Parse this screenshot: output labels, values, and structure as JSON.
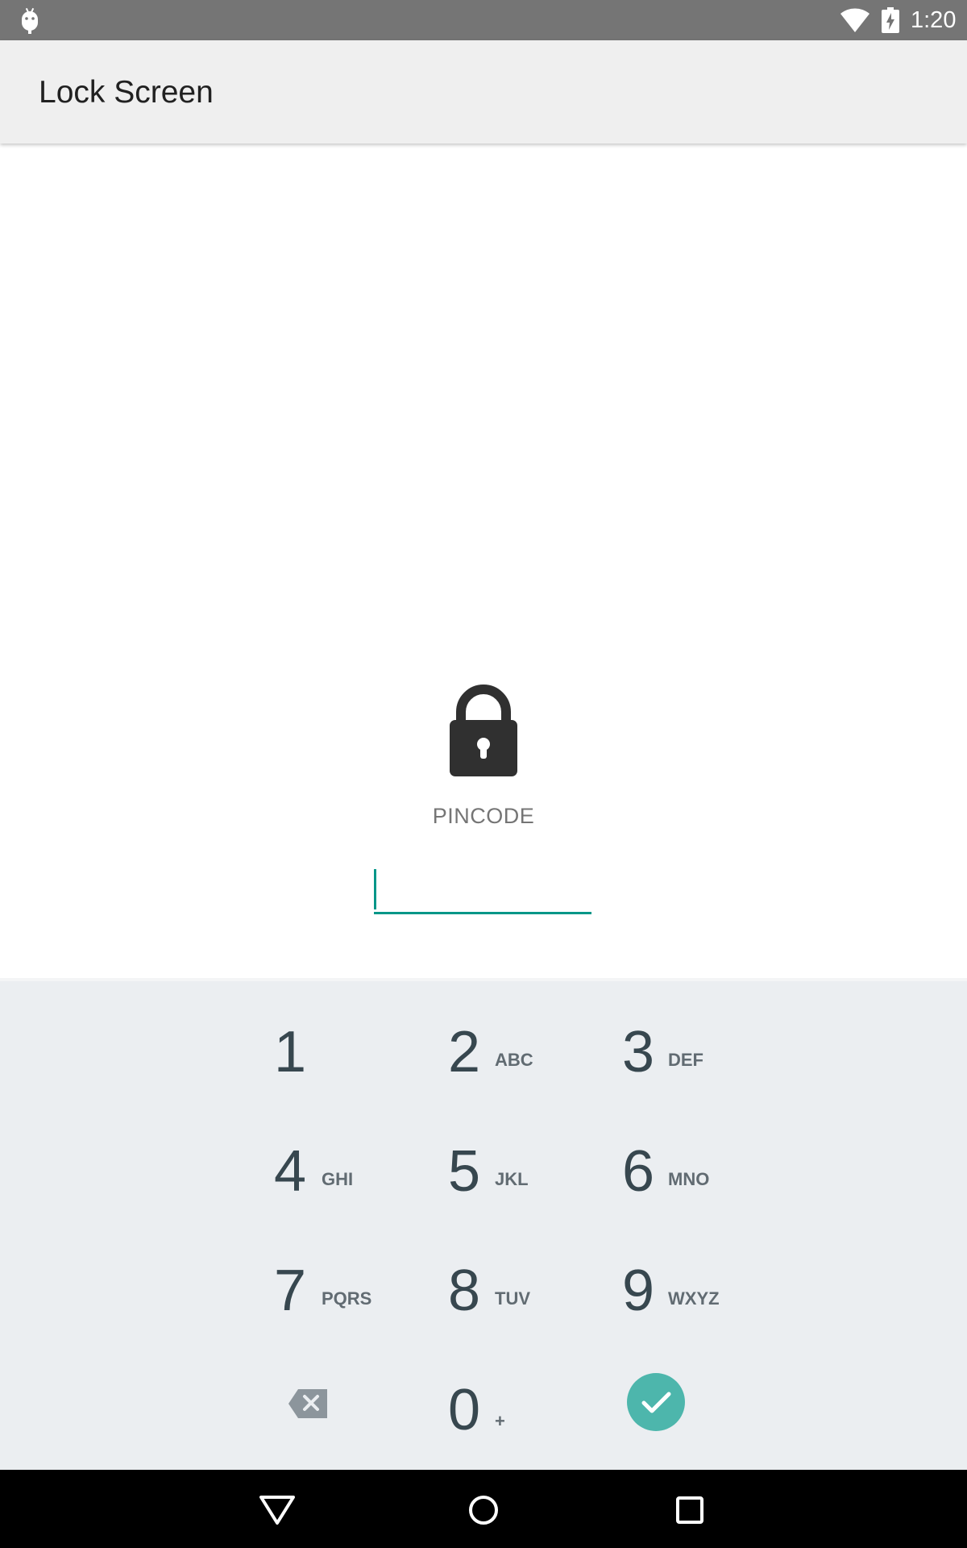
{
  "status_bar": {
    "time": "1:20",
    "icons": [
      "android-icon",
      "wifi-icon",
      "battery-charging-icon"
    ]
  },
  "app_bar": {
    "title": "Lock Screen"
  },
  "lock": {
    "icon": "lock-icon",
    "label": "PINCODE",
    "input_value": ""
  },
  "keypad": {
    "keys": [
      {
        "digit": "1",
        "letters": ""
      },
      {
        "digit": "2",
        "letters": "ABC"
      },
      {
        "digit": "3",
        "letters": "DEF"
      },
      {
        "digit": "4",
        "letters": "GHI"
      },
      {
        "digit": "5",
        "letters": "JKL"
      },
      {
        "digit": "6",
        "letters": "MNO"
      },
      {
        "digit": "7",
        "letters": "PQRS"
      },
      {
        "digit": "8",
        "letters": "TUV"
      },
      {
        "digit": "9",
        "letters": "WXYZ"
      },
      {
        "digit": "0",
        "letters": "+"
      }
    ],
    "backspace_icon": "backspace-icon",
    "confirm_icon": "check-icon",
    "accent_color": "#4db6ac"
  },
  "nav_bar": {
    "icons": [
      "back-icon",
      "home-icon",
      "recents-icon"
    ]
  },
  "colors": {
    "status_bar": "#757575",
    "app_bar": "#efefef",
    "input_underline": "#009688",
    "keypad_background": "#ebeef1"
  }
}
